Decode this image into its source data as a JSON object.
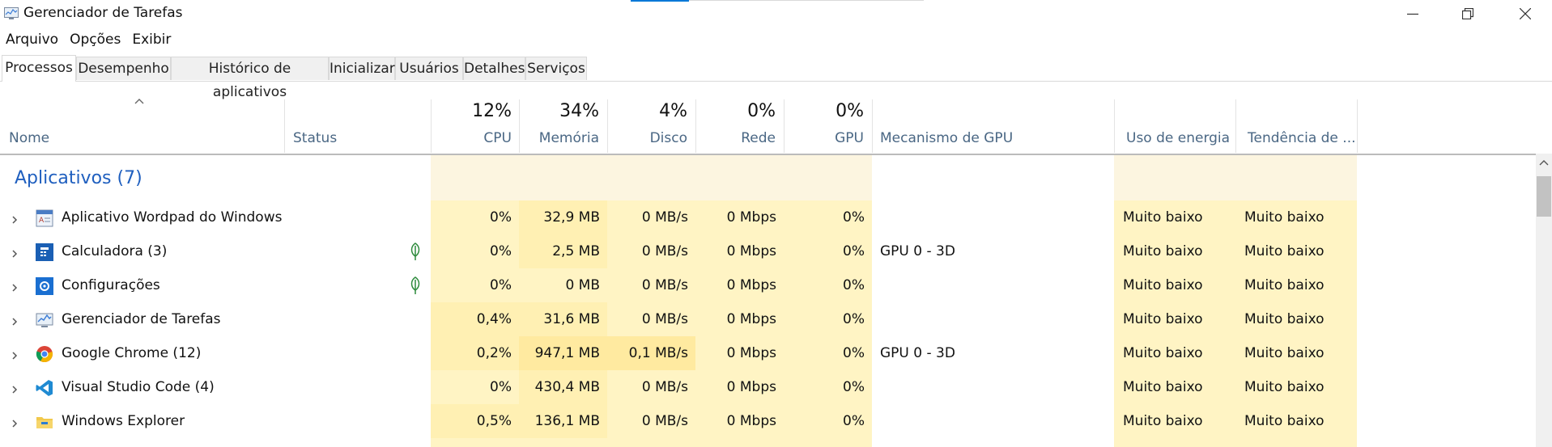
{
  "window": {
    "title": "Gerenciador de Tarefas"
  },
  "menu": [
    "Arquivo",
    "Opções",
    "Exibir"
  ],
  "tabs": [
    "Processos",
    "Desempenho",
    "Histórico de aplicativos",
    "Inicializar",
    "Usuários",
    "Detalhes",
    "Serviços"
  ],
  "columns": {
    "name": "Nome",
    "status": "Status",
    "cpu": {
      "pct": "12%",
      "label": "CPU"
    },
    "memory": {
      "pct": "34%",
      "label": "Memória"
    },
    "disk": {
      "pct": "4%",
      "label": "Disco"
    },
    "network": {
      "pct": "0%",
      "label": "Rede"
    },
    "gpu": {
      "pct": "0%",
      "label": "GPU"
    },
    "gpu_engine": "Mecanismo de GPU",
    "power": "Uso de energia",
    "power_trend": "Tendência de ..."
  },
  "group": {
    "label": "Aplicativos (7)"
  },
  "rows": [
    {
      "name": "Aplicativo Wordpad do Windows",
      "icon": "wordpad-icon",
      "suspended": false,
      "cpu": "0%",
      "memory": "32,9 MB",
      "disk": "0 MB/s",
      "network": "0 Mbps",
      "gpu": "0%",
      "gpu_engine": "",
      "power": "Muito baixo",
      "power_trend": "Muito baixo"
    },
    {
      "name": "Calculadora (3)",
      "icon": "calculator-icon",
      "suspended": true,
      "cpu": "0%",
      "memory": "2,5 MB",
      "disk": "0 MB/s",
      "network": "0 Mbps",
      "gpu": "0%",
      "gpu_engine": "GPU 0 - 3D",
      "power": "Muito baixo",
      "power_trend": "Muito baixo"
    },
    {
      "name": "Configurações",
      "icon": "settings-icon",
      "suspended": true,
      "cpu": "0%",
      "memory": "0 MB",
      "disk": "0 MB/s",
      "network": "0 Mbps",
      "gpu": "0%",
      "gpu_engine": "",
      "power": "Muito baixo",
      "power_trend": "Muito baixo"
    },
    {
      "name": "Gerenciador de Tarefas",
      "icon": "task-manager-icon",
      "suspended": false,
      "cpu": "0,4%",
      "memory": "31,6 MB",
      "disk": "0 MB/s",
      "network": "0 Mbps",
      "gpu": "0%",
      "gpu_engine": "",
      "power": "Muito baixo",
      "power_trend": "Muito baixo"
    },
    {
      "name": "Google Chrome (12)",
      "icon": "chrome-icon",
      "suspended": false,
      "cpu": "0,2%",
      "memory": "947,1 MB",
      "disk": "0,1 MB/s",
      "network": "0 Mbps",
      "gpu": "0%",
      "gpu_engine": "GPU 0 - 3D",
      "power": "Muito baixo",
      "power_trend": "Muito baixo"
    },
    {
      "name": "Visual Studio Code (4)",
      "icon": "vscode-icon",
      "suspended": false,
      "cpu": "0%",
      "memory": "430,4 MB",
      "disk": "0 MB/s",
      "network": "0 Mbps",
      "gpu": "0%",
      "gpu_engine": "",
      "power": "Muito baixo",
      "power_trend": "Muito baixo"
    },
    {
      "name": "Windows Explorer",
      "icon": "file-explorer-icon",
      "suspended": false,
      "cpu": "0,5%",
      "memory": "136,1 MB",
      "disk": "0 MB/s",
      "network": "0 Mbps",
      "gpu": "0%",
      "gpu_engine": "",
      "power": "Muito baixo",
      "power_trend": "Muito baixo"
    }
  ],
  "heat_colors": {
    "header_light": "#fcf5e0",
    "light": "#fff4c4",
    "medium": "#fff0b3",
    "strong": "#ffeaa0",
    "group_accent": "#1f5fbf"
  }
}
